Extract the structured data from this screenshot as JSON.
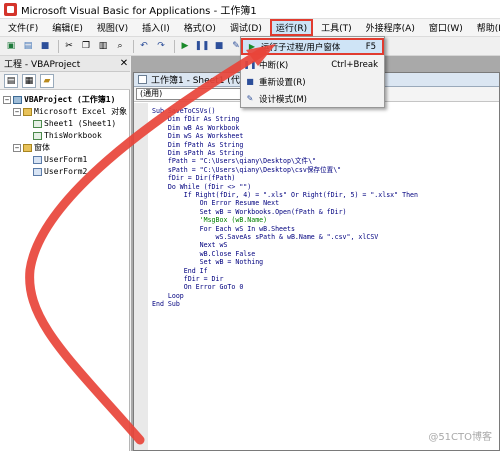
{
  "window": {
    "title": "Microsoft Visual Basic for Applications - 工作簿1"
  },
  "menubar": [
    {
      "label": "文件(F)"
    },
    {
      "label": "编辑(E)"
    },
    {
      "label": "视图(V)"
    },
    {
      "label": "插入(I)"
    },
    {
      "label": "格式(O)"
    },
    {
      "label": "调试(D)"
    },
    {
      "label": "运行(R)"
    },
    {
      "label": "工具(T)"
    },
    {
      "label": "外接程序(A)"
    },
    {
      "label": "窗口(W)"
    },
    {
      "label": "帮助(H)"
    }
  ],
  "run_menu": {
    "items": [
      {
        "label": "运行子过程/用户窗体",
        "shortcut": "F5",
        "icon": "play-icon"
      },
      {
        "label": "中断(K)",
        "shortcut": "Ctrl+Break",
        "icon": "pause-icon"
      },
      {
        "label": "重新设置(R)",
        "shortcut": "",
        "icon": "stop-icon"
      },
      {
        "label": "设计模式(M)",
        "shortcut": "",
        "icon": "design-mode-icon"
      }
    ]
  },
  "project_pane": {
    "title": "工程 - VBAProject",
    "tree": [
      {
        "text": "VBAProject (工作簿1)"
      },
      {
        "text": "Microsoft Excel 对象"
      },
      {
        "text": "Sheet1 (Sheet1)"
      },
      {
        "text": "ThisWorkbook"
      },
      {
        "text": "窗体"
      },
      {
        "text": "UserForm1"
      },
      {
        "text": "UserForm2"
      }
    ]
  },
  "code_window": {
    "title": "工作簿1 - Sheet1 (代码)",
    "object_combo": "(通用)",
    "lines": [
      "Sub SaveToCSVs()",
      "    Dim fDir As String",
      "    Dim wB As Workbook",
      "    Dim wS As Worksheet",
      "    Dim fPath As String",
      "    Dim sPath As String",
      "    fPath = \"C:\\Users\\qiany\\Desktop\\文件\\\"",
      "    sPath = \"C:\\Users\\qiany\\Desktop\\csv保存位置\\\"",
      "    fDir = Dir(fPath)",
      "    Do While (fDir <> \"\")",
      "        If Right(fDir, 4) = \".xls\" Or Right(fDir, 5) = \".xlsx\" Then",
      "            On Error Resume Next",
      "            Set wB = Workbooks.Open(fPath & fDir)",
      "            'MsgBox (wB.Name)",
      "            For Each wS In wB.Sheets",
      "                wS.SaveAs sPath & wB.Name & \".csv\", xlCSV",
      "            Next wS",
      "            wB.Close False",
      "            Set wB = Nothing",
      "        End If",
      "        fDir = Dir",
      "        On Error GoTo 0",
      "    Loop",
      "End Sub"
    ]
  },
  "watermark": "@51CTO博客",
  "colors": {
    "highlight_border": "#e13b2f",
    "arrow": "#e8443a",
    "code_keyword": "#00007f",
    "comment": "#008000"
  }
}
